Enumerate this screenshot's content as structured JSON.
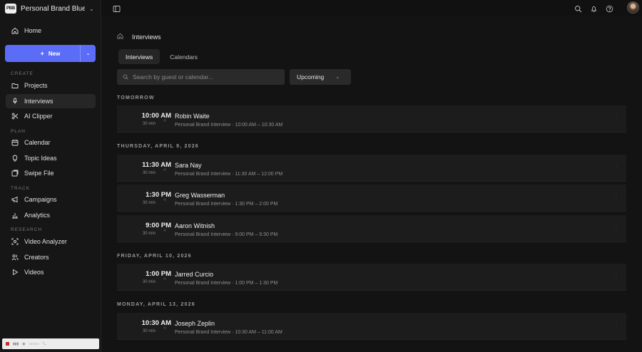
{
  "workspace": {
    "badge": "PBB",
    "name": "Personal Brand Blue..."
  },
  "sidebar": {
    "home": "Home",
    "new_button": "New",
    "sections": {
      "create": "CREATE",
      "plan": "PLAN",
      "track": "TRACK",
      "research": "RESEARCH"
    },
    "items": {
      "projects": "Projects",
      "interviews": "Interviews",
      "ai_clipper": "AI Clipper",
      "calendar": "Calendar",
      "topic_ideas": "Topic Ideas",
      "swipe_file": "Swipe File",
      "campaigns": "Campaigns",
      "analytics": "Analytics",
      "video_analyzer": "Video Analyzer",
      "creators": "Creators",
      "videos": "Videos"
    }
  },
  "breadcrumb": {
    "current": "Interviews"
  },
  "tabs": [
    "Interviews",
    "Calendars"
  ],
  "search": {
    "placeholder": "Search by guest or calendar..."
  },
  "filter": {
    "selected": "Upcoming"
  },
  "groups": [
    {
      "label": "TOMORROW",
      "rows": [
        {
          "time": "10:00 AM",
          "duration": "30 min",
          "guest": "Robin Waite",
          "details": "Personal Brand Interview · 10:00 AM – 10:30 AM"
        }
      ]
    },
    {
      "label": "THURSDAY, APRIL 9, 2026",
      "rows": [
        {
          "time": "11:30 AM",
          "duration": "30 min",
          "guest": "Sara Nay",
          "details": "Personal Brand Interview · 11:30 AM – 12:00 PM"
        },
        {
          "time": "1:30 PM",
          "duration": "30 min",
          "guest": "Greg Wasserman",
          "details": "Personal Brand Interview · 1:30 PM – 2:00 PM"
        },
        {
          "time": "9:00 PM",
          "duration": "30 min",
          "guest": "Aaron Witnish",
          "details": "Personal Brand Interview · 9:00 PM – 9:30 PM"
        }
      ]
    },
    {
      "label": "FRIDAY, APRIL 10, 2026",
      "rows": [
        {
          "time": "1:00 PM",
          "duration": "30 min",
          "guest": "Jarred Curcio",
          "details": "Personal Brand Interview · 1:00 PM – 1:30 PM"
        }
      ]
    },
    {
      "label": "MONDAY, APRIL 13, 2026",
      "rows": [
        {
          "time": "10:30 AM",
          "duration": "30 min",
          "guest": "Joseph Zeplin",
          "details": "Personal Brand Interview · 10:30 AM – 11:00 AM"
        }
      ]
    }
  ],
  "colors": {
    "accent": "#5b6cf6",
    "background": "#131313",
    "sidebar": "#161616"
  }
}
